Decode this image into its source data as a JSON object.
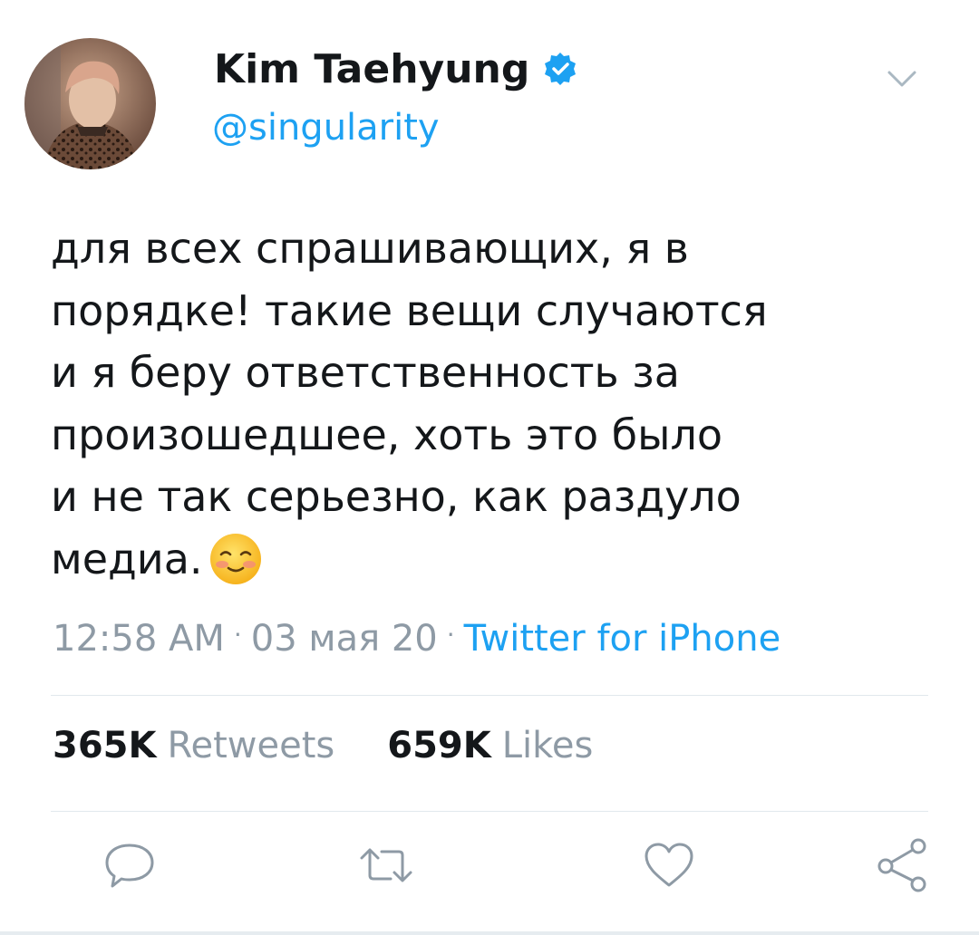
{
  "tweet": {
    "display_name": "Kim Taehyung",
    "handle": "@singularity",
    "verified": true,
    "text": "для всех спрашивающих, я в\nпорядке! такие вещи случаются\nи я беру ответственность за\nпроизошедшее, хоть это было\nи не так серьезно, как раздуло\nмедиа.",
    "emoji": "smiling-face-icon",
    "time": "12:58 AM",
    "date": "03 мая 20",
    "source": "Twitter for iPhone",
    "retweets_count": "365K",
    "retweets_label": "Retweets",
    "likes_count": "659K",
    "likes_label": "Likes"
  },
  "icons": {
    "verified": "verified-badge-icon",
    "menu": "chevron-down-icon",
    "reply": "reply-icon",
    "retweet": "retweet-icon",
    "like": "heart-icon",
    "share": "share-icon"
  },
  "colors": {
    "accent": "#1da1f2",
    "text": "#14171a",
    "muted": "#8e9aa5",
    "divider": "#e1e8ed"
  }
}
